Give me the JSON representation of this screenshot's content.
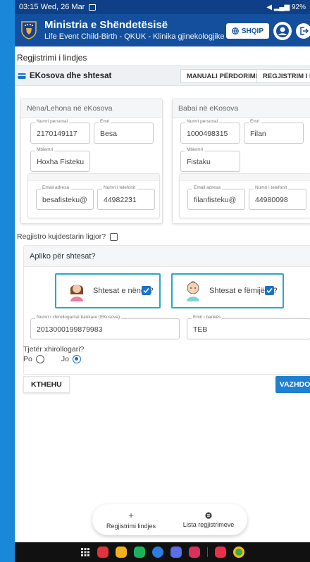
{
  "status_bar": {
    "time_date": "03:15  Wed, 26 Mar",
    "right_text": "92%"
  },
  "header": {
    "title": "Ministria e Shëndetësisë",
    "subtitle": "Life Event Child-Birth - QKUK - Klinika gjinekologjike",
    "lang_button": "SHQIP"
  },
  "page_title": "Regjistrimi i lindjes",
  "toolbar": {
    "section_title": "EKosova dhe shtesat",
    "manual_button": "MANUALI PËRDORIMIT",
    "register_button": "REGJISTRIM I RI"
  },
  "mother": {
    "header": "Nëna/Lehona në eKosova",
    "personal_number": {
      "label": "Numri personal",
      "value": "2170149117"
    },
    "first_name": {
      "label": "Emri",
      "value": "Besa"
    },
    "last_name": {
      "label": "Mbiemri",
      "value": "Hoxha Fisteku"
    },
    "email": {
      "label": "Email adresa",
      "value": "besafisteku@"
    },
    "phone": {
      "label": "Numri i telefonit",
      "value": "44982231"
    }
  },
  "father": {
    "header": "Babai në eKosova",
    "personal_number": {
      "label": "Numri personal",
      "value": "1000498315"
    },
    "first_name": {
      "label": "Emri",
      "value": "Filan"
    },
    "last_name": {
      "label": "Mbiemri",
      "value": "Fistaku"
    },
    "email": {
      "label": "Email adresa",
      "value": "filanfisteku@"
    },
    "phone": {
      "label": "Numri i telefonit",
      "value": "44980098"
    }
  },
  "guardian_checkbox": {
    "label": "Regjistro kujdestarin ligjor?",
    "checked": false
  },
  "benefits": {
    "header": "Apliko për shtesat?",
    "mother_option": {
      "label": "Shtesat e nënës?",
      "checked": true
    },
    "family_option": {
      "label": "Shtesat e fëmijëve?",
      "checked": true
    },
    "bank_account": {
      "label": "Numri i xhirollogarisë bankare (EKosova)",
      "value": "2013000199879983"
    },
    "bank_name": {
      "label": "Emri i bankës",
      "value": "TEB"
    },
    "other_account_question": "Tjetër xhirollogari?",
    "radio_yes": "Po",
    "radio_no": "Jo",
    "selected": "Jo"
  },
  "buttons": {
    "back": "KTHEHU",
    "next": "VAZHDO"
  },
  "bottom_nav": {
    "item1": "Regjistrimi lindjes",
    "item2": "Lista regjistrimeve"
  },
  "colors": {
    "header_blue": "#134f9c",
    "status_bar": "#0f3f86",
    "accent": "#1a73c9",
    "option_border": "#2aa7c8",
    "frame": "#1a88d8"
  }
}
